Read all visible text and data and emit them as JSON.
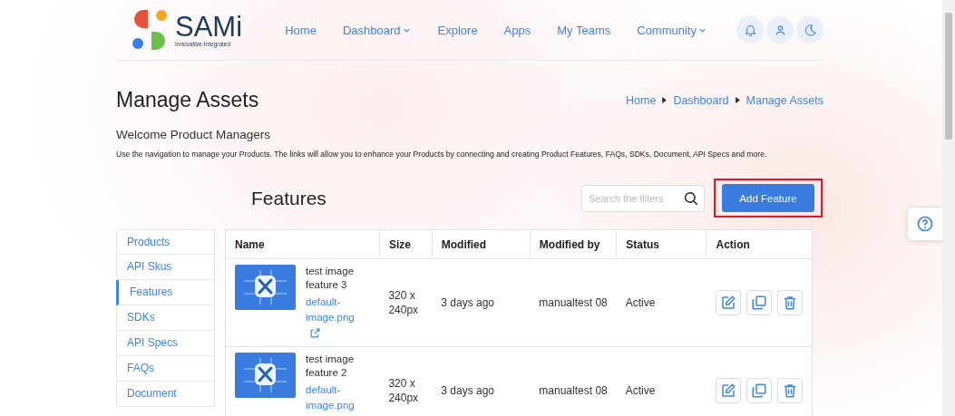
{
  "logo": {
    "name": "SAMi",
    "tagline": "Innovative-Integrated"
  },
  "nav": [
    {
      "label": "Home",
      "dropdown": false
    },
    {
      "label": "Dashboard",
      "dropdown": true
    },
    {
      "label": "Explore",
      "dropdown": false
    },
    {
      "label": "Apps",
      "dropdown": false
    },
    {
      "label": "My Teams",
      "dropdown": false
    },
    {
      "label": "Community",
      "dropdown": true
    }
  ],
  "page": {
    "title": "Manage Assets",
    "breadcrumb": [
      "Home",
      "Dashboard",
      "Manage Assets"
    ],
    "welcome": "Welcome Product Managers",
    "description": "Use the navigation to manage your Products. The links will allow you to enhance your Products by connecting and creating Product Features, FAQs, SDKs, Document, API Specs and more."
  },
  "features": {
    "title": "Features",
    "search": {
      "placeholder": "Search the filters"
    },
    "add_button": {
      "label": "Add Feature",
      "highlighted": true
    }
  },
  "sidebar": {
    "items": [
      {
        "label": "Products",
        "selected": false
      },
      {
        "label": "API Skus",
        "selected": false
      },
      {
        "label": "Features",
        "selected": true
      },
      {
        "label": "SDKs",
        "selected": false
      },
      {
        "label": "API Specs",
        "selected": false
      },
      {
        "label": "FAQs",
        "selected": false
      },
      {
        "label": "Document",
        "selected": false
      }
    ]
  },
  "table": {
    "columns": [
      "Name",
      "Size",
      "Modified",
      "Modified by",
      "Status",
      "Action"
    ],
    "rows": [
      {
        "name": "test image feature 3",
        "file": "default-image.png",
        "size": "320 x 240px",
        "modified": "3 days ago",
        "modified_by": "manualtest 08",
        "status": "Active"
      },
      {
        "name": "test image feature 2",
        "file": "default-image.png",
        "size": "320 x 240px",
        "modified": "3 days ago",
        "modified_by": "manualtest 08",
        "status": "Active"
      }
    ]
  }
}
